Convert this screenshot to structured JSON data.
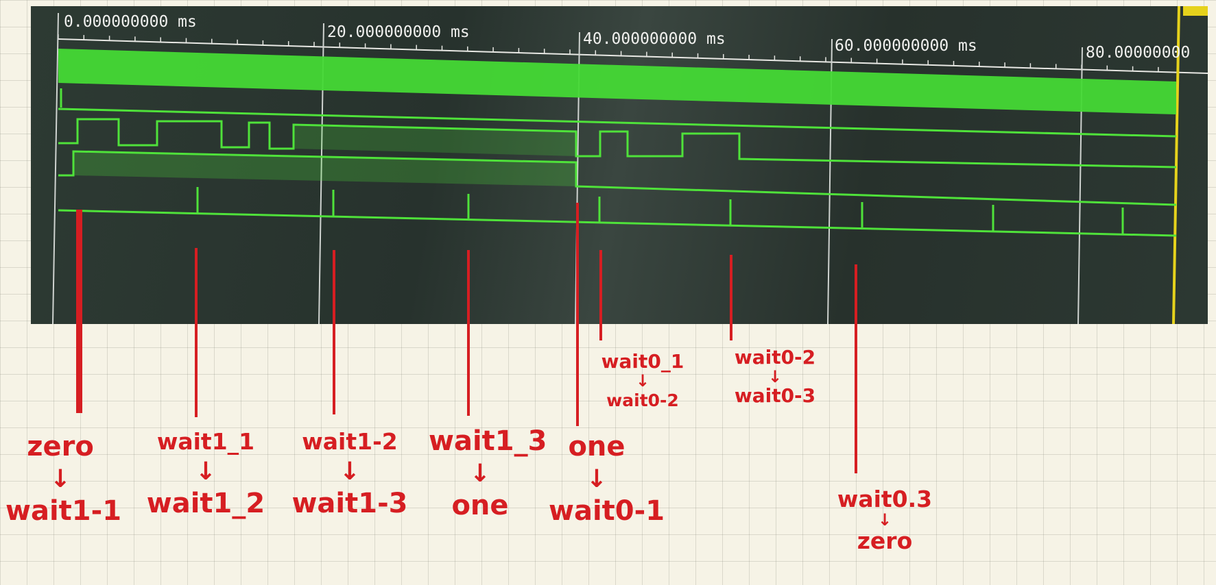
{
  "timeline": {
    "unit": "ms",
    "labels": [
      "0.000000000 ms",
      "20.000000000 ms",
      "40.000000000 ms",
      "60.000000000 ms",
      "80.00000000"
    ]
  },
  "colors": {
    "trace": "#4fe23a",
    "ink": "#d61e22",
    "grid_paper": "#f6f3e6"
  },
  "transitions": [
    {
      "from": "zero",
      "to": "wait1-1"
    },
    {
      "from": "wait1_1",
      "to": "wait1_2"
    },
    {
      "from": "wait1-2",
      "to": "wait1-3"
    },
    {
      "from": "wait1_3",
      "to": "one"
    },
    {
      "from": "one",
      "to": "wait0-1"
    },
    {
      "from": "wait0_1",
      "to": "wait0-2"
    },
    {
      "from": "wait0-2",
      "to": "wait0-3"
    },
    {
      "from": "wait0.3",
      "to": "zero"
    }
  ],
  "arrow": "↓"
}
